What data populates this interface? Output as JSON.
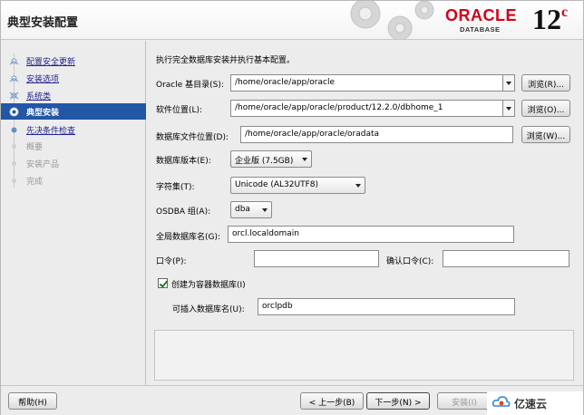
{
  "header": {
    "title": "典型安装配置",
    "logo": {
      "brand": "ORACLE",
      "sub": "DATABASE",
      "version": "12",
      "version_sup": "c"
    }
  },
  "nav": {
    "items": [
      {
        "label": "配置安全更新",
        "state": "done"
      },
      {
        "label": "安装选项",
        "state": "done"
      },
      {
        "label": "系统类",
        "state": "done"
      },
      {
        "label": "典型安装",
        "state": "current"
      },
      {
        "label": "先决条件检查",
        "state": "done"
      },
      {
        "label": "概要",
        "state": "future"
      },
      {
        "label": "安装产品",
        "state": "future"
      },
      {
        "label": "完成",
        "state": "future"
      }
    ]
  },
  "main": {
    "description": "执行完全数据库安装并执行基本配置。",
    "oracle_base": {
      "label": "Oracle 基目录(S):",
      "value": "/home/oracle/app/oracle",
      "browse": "浏览(R)..."
    },
    "software_location": {
      "label": "软件位置(L):",
      "value": "/home/oracle/app/oracle/product/12.2.0/dbhome_1",
      "browse": "浏览(O)..."
    },
    "db_file_location": {
      "label": "数据库文件位置(D):",
      "value": "/home/oracle/app/oracle/oradata",
      "browse": "浏览(W)..."
    },
    "db_edition": {
      "label": "数据库版本(E):",
      "value": "企业版 (7.5GB)"
    },
    "charset": {
      "label": "字符集(T):",
      "value": "Unicode (AL32UTF8)"
    },
    "osdba": {
      "label": "OSDBA 组(A):",
      "value": "dba"
    },
    "global_db_name": {
      "label": "全局数据库名(G):",
      "value": "orcl.localdomain"
    },
    "password": {
      "label": "口令(P):",
      "value": ""
    },
    "confirm_password": {
      "label": "确认口令(C):",
      "value": ""
    },
    "container_db": {
      "label": "创建为容器数据库(I)",
      "checked": true
    },
    "pluggable_db": {
      "label": "可插入数据库名(U):",
      "value": "orclpdb"
    }
  },
  "footer": {
    "help": "帮助(H)",
    "back": "< 上一步(B)",
    "next": "下一步(N) >",
    "install": "安装(I)"
  },
  "watermark": {
    "text": "亿速云"
  }
}
